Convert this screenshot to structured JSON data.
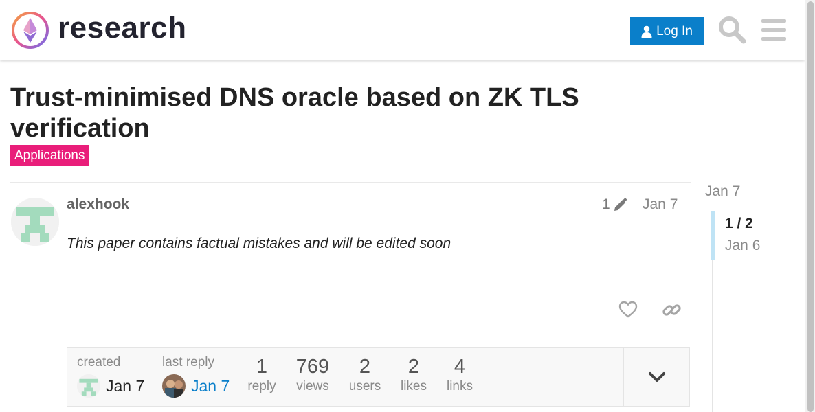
{
  "header": {
    "site_name": "research",
    "login_label": "Log In"
  },
  "topic": {
    "title": "Trust-minimised DNS oracle based on ZK TLS verification",
    "category": "Applications",
    "category_color": "#e91e7a"
  },
  "post": {
    "username": "alexhook",
    "edit_count": "1",
    "date": "Jan 7",
    "body": "This paper contains factual mistakes and will be edited soon"
  },
  "topic_map": {
    "created_label": "created",
    "created_date": "Jan 7",
    "last_reply_label": "last reply",
    "last_reply_date": "Jan 7",
    "stats": [
      {
        "value": "1",
        "label": "reply"
      },
      {
        "value": "769",
        "label": "views"
      },
      {
        "value": "2",
        "label": "users"
      },
      {
        "value": "2",
        "label": "likes"
      },
      {
        "value": "4",
        "label": "links"
      }
    ]
  },
  "timeline": {
    "top_date": "Jan 7",
    "position": "1 / 2",
    "position_date": "Jan 6"
  },
  "colors": {
    "accent": "#0a7fca",
    "avatar_green": "#a3dbbd"
  }
}
